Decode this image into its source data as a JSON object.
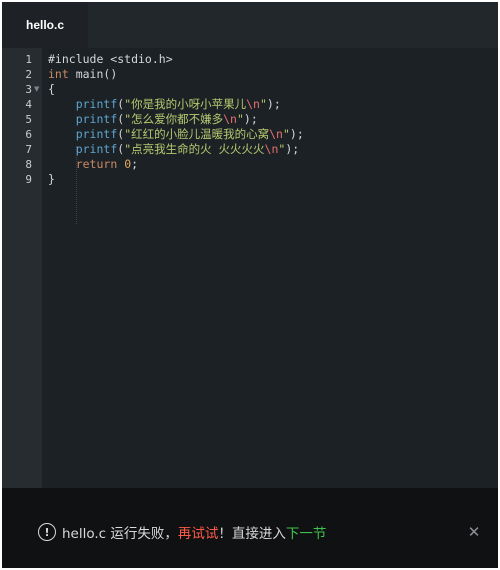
{
  "tabs": [
    {
      "label": "hello.c",
      "active": true
    }
  ],
  "editor": {
    "language": "c",
    "line_numbers": [
      "1",
      "2",
      "3",
      "4",
      "5",
      "6",
      "7",
      "8",
      "9"
    ],
    "fold_marker_line": "3",
    "fold_icon": "fold-arrow-icon",
    "lines": [
      [
        {
          "t": "#include <stdio.h>",
          "c": "plain"
        }
      ],
      [
        {
          "t": "int",
          "c": "kw"
        },
        {
          "t": " main()",
          "c": "plain"
        }
      ],
      [
        {
          "t": "{",
          "c": "plain"
        }
      ],
      [
        {
          "t": "    ",
          "c": "plain"
        },
        {
          "t": "printf",
          "c": "fn"
        },
        {
          "t": "(",
          "c": "plain"
        },
        {
          "t": "\"你是我的小呀小苹果儿",
          "c": "str"
        },
        {
          "t": "\\n",
          "c": "esc"
        },
        {
          "t": "\"",
          "c": "str"
        },
        {
          "t": ");",
          "c": "plain"
        }
      ],
      [
        {
          "t": "    ",
          "c": "plain"
        },
        {
          "t": "printf",
          "c": "fn"
        },
        {
          "t": "(",
          "c": "plain"
        },
        {
          "t": "\"怎么爱你都不嫌多",
          "c": "str"
        },
        {
          "t": "\\n",
          "c": "esc"
        },
        {
          "t": "\"",
          "c": "str"
        },
        {
          "t": ");",
          "c": "plain"
        }
      ],
      [
        {
          "t": "    ",
          "c": "plain"
        },
        {
          "t": "printf",
          "c": "fn"
        },
        {
          "t": "(",
          "c": "plain"
        },
        {
          "t": "\"红红的小脸儿温暖我的心窝",
          "c": "str"
        },
        {
          "t": "\\n",
          "c": "esc"
        },
        {
          "t": "\"",
          "c": "str"
        },
        {
          "t": ");",
          "c": "plain"
        }
      ],
      [
        {
          "t": "    ",
          "c": "plain"
        },
        {
          "t": "printf",
          "c": "fn"
        },
        {
          "t": "(",
          "c": "plain"
        },
        {
          "t": "\"点亮我生命的火 火火火火",
          "c": "str"
        },
        {
          "t": "\\n",
          "c": "esc"
        },
        {
          "t": "\"",
          "c": "str"
        },
        {
          "t": ");",
          "c": "plain"
        }
      ],
      [
        {
          "t": "    ",
          "c": "plain"
        },
        {
          "t": "return",
          "c": "kw"
        },
        {
          "t": " ",
          "c": "plain"
        },
        {
          "t": "0",
          "c": "num"
        },
        {
          "t": ";",
          "c": "plain"
        }
      ],
      [
        {
          "t": "}",
          "c": "plain"
        }
      ]
    ]
  },
  "status": {
    "icon": "alert-circle-icon",
    "icon_glyph": "!",
    "message": "hello.c 运行失败，",
    "retry_label": "再试试",
    "middle": "！直接进入",
    "next_label": "下一节",
    "close_icon": "close-icon",
    "close_glyph": "✕"
  },
  "colors": {
    "editor_bg": "#1c2125",
    "gutter_bg": "#272c31",
    "status_bg": "#0f1112",
    "retry": "#ff5a48",
    "next": "#3fc24f",
    "keyword": "#c98a62",
    "function": "#5da5cf",
    "string": "#b7c86f",
    "escape": "#e36f6f"
  }
}
